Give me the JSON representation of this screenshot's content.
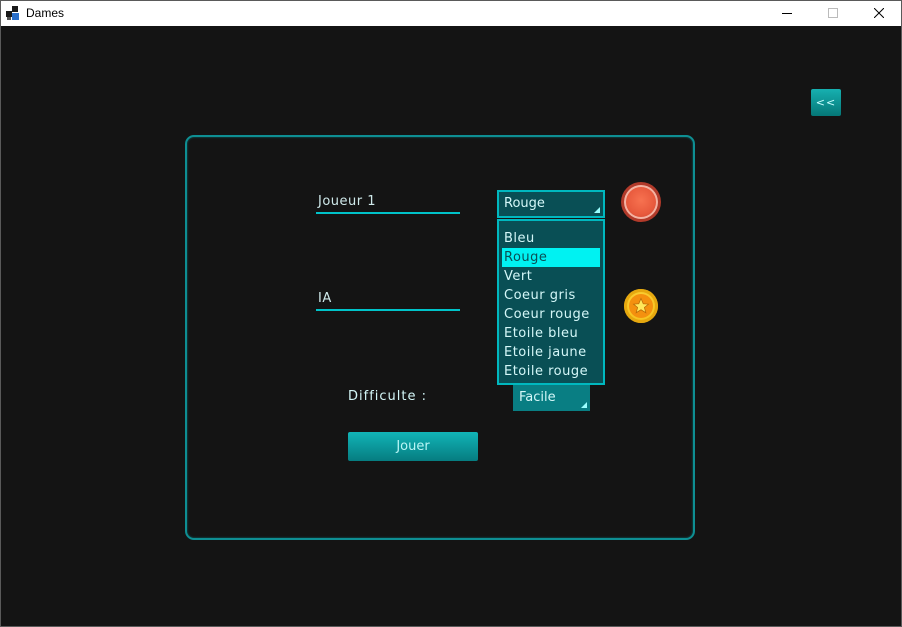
{
  "window": {
    "title": "Dames"
  },
  "back_button": {
    "label": "<<"
  },
  "player1": {
    "name": "Joueur 1",
    "color_selected": "Rouge",
    "piece_icon": "red-piece-icon"
  },
  "player2": {
    "name": "IA",
    "piece_icon": "gold-star-piece-icon"
  },
  "color_dropdown": {
    "items": [
      "Bleu",
      "Rouge",
      "Vert",
      "Coeur gris",
      "Coeur rouge",
      "Etoile bleu",
      "Etoile jaune",
      "Etoile rouge"
    ],
    "highlighted": "Rouge"
  },
  "difficulty": {
    "label": "Difficulte :",
    "value": "Facile"
  },
  "play_button": {
    "label": "Jouer"
  },
  "colors": {
    "background": "#141414",
    "accent": "#00c3c9",
    "highlight": "#00f2f2"
  }
}
